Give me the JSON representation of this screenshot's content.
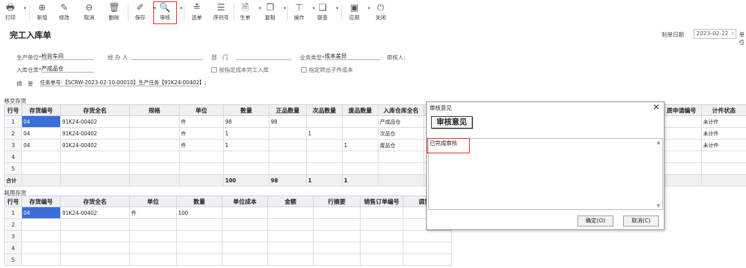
{
  "toolbar": {
    "print": "打印",
    "add": "新增",
    "edit": "修改",
    "cancel": "取消",
    "delete": "删除",
    "save": "保存",
    "audit": "审核",
    "select": "选单",
    "serial": "序列号",
    "generate": "生单",
    "copy": "复制",
    "operate": "操作",
    "lookup": "联查",
    "apply": "应用",
    "close": "关闭"
  },
  "header": {
    "title": "完工入库单",
    "date_label": "制单日期",
    "date_value": "2023-02-22",
    "unit_label": "单位"
  },
  "form": {
    "prod_unit_label": "生产单位*",
    "prod_unit_value": "检验车间",
    "handler_label": "经 办 人",
    "dept_label": "部　门",
    "biz_type_label": "业务类型*",
    "biz_type_value": "成本差异",
    "auditor_label": "审核人:",
    "warehouse_label": "入库仓库*",
    "warehouse_value": "产成品仓",
    "chk_cost_label": "按指定成本完工入库",
    "chk_sub_label": "指定转出子件成本",
    "summary_label": "摘　要",
    "summary_value": "任务单号:【SCRW-2023-02-10-00010】生产任务【91K24-00402】;"
  },
  "upper": {
    "section_label": "移交存货",
    "columns": [
      "行号",
      "存货编号",
      "存货全名",
      "规格",
      "单位",
      "数量",
      "正品数量",
      "次品数量",
      "废品数量",
      "入库仓库全名",
      "质申请编号",
      "计件状态"
    ],
    "rows": [
      [
        "1",
        "04",
        "91K24-00402",
        "",
        "件",
        "98",
        "98",
        "",
        "",
        "产成品仓",
        "",
        "未计件"
      ],
      [
        "2",
        "04",
        "91K24-00402",
        "",
        "件",
        "1",
        "",
        "1",
        "",
        "次品仓",
        "",
        "未计件"
      ],
      [
        "3",
        "04",
        "91K24-00402",
        "",
        "件",
        "1",
        "",
        "",
        "1",
        "废品仓",
        "",
        "未计件"
      ],
      [
        "4",
        "",
        "",
        "",
        "",
        "",
        "",
        "",
        "",
        "",
        "",
        ""
      ],
      [
        "5",
        "",
        "",
        "",
        "",
        "",
        "",
        "",
        "",
        "",
        "",
        ""
      ]
    ],
    "total": [
      "合计",
      "",
      "",
      "",
      "",
      "100",
      "98",
      "1",
      "1",
      "",
      "",
      ""
    ]
  },
  "lower": {
    "section_label": "耗用存货",
    "columns": [
      "行号",
      "存货编号",
      "存货全名",
      "单位",
      "数量",
      "单位成本",
      "金额",
      "行摘要",
      "销售订单编号",
      "调货申"
    ],
    "rows": [
      [
        "1",
        "04",
        "91K24-00402",
        "件",
        "100",
        "",
        "",
        "",
        "",
        ""
      ],
      [
        "2",
        "",
        "",
        "",
        "",
        "",
        "",
        "",
        "",
        ""
      ],
      [
        "3",
        "",
        "",
        "",
        "",
        "",
        "",
        "",
        "",
        ""
      ],
      [
        "4",
        "",
        "",
        "",
        "",
        "",
        "",
        "",
        "",
        ""
      ],
      [
        "5",
        "",
        "",
        "",
        "",
        "",
        "",
        "",
        "",
        ""
      ]
    ]
  },
  "dialog": {
    "title": "审核意见",
    "heading": "审核意见",
    "text": "已完成审核",
    "ok": "确定(O)",
    "cancel": "取消(C)"
  },
  "colors": {
    "highlight": "#e02020",
    "selection": "#3a6fd8",
    "header_bg": "#eef0f3"
  }
}
